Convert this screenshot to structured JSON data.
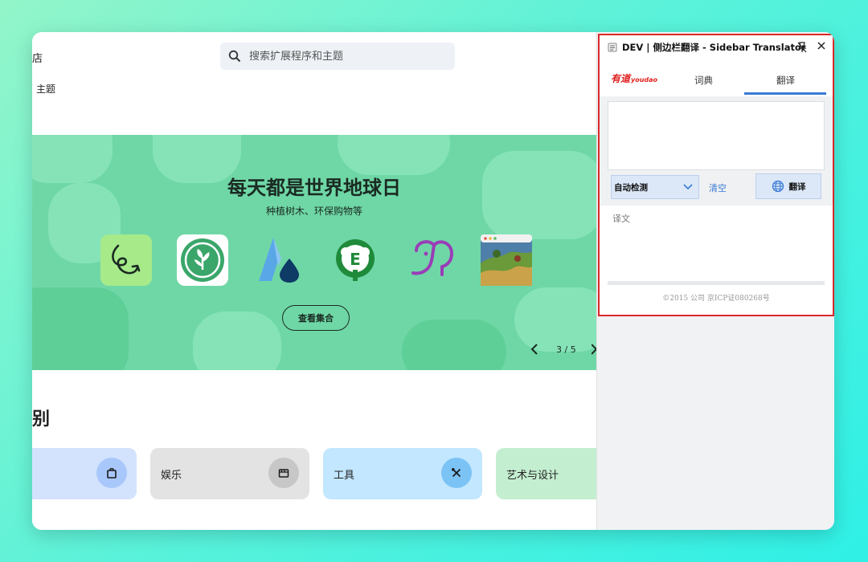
{
  "store": {
    "nav_store": "商店",
    "nav_themes": "主题",
    "search": {
      "placeholder": "搜索扩展程序和主题"
    },
    "hero": {
      "title": "每天都是世界地球日",
      "subtitle": "种植树木、环保购物等",
      "button": "查看集合",
      "pager": "3 / 5",
      "app_icons": [
        "loop-arrow-app-icon",
        "leaf-app-icon",
        "water-drop-app-icon",
        "tree-e-app-icon",
        "elephant-app-icon",
        "landscape-app-icon"
      ]
    },
    "categories_heading": "类别",
    "categories": [
      {
        "label": "",
        "icon": "shopping-bag-icon",
        "bg": "#d3e3fd"
      },
      {
        "label": "娱乐",
        "icon": "clapperboard-icon",
        "bg": "#e3e3e3"
      },
      {
        "label": "工具",
        "icon": "tools-icon",
        "bg": "#c2e7ff"
      },
      {
        "label": "艺术与设计",
        "icon": "",
        "bg": "#c4eed0"
      }
    ]
  },
  "translator": {
    "title": "DEV | 侧边栏翻译 - Sidebar Translator",
    "logo_cn": "有道",
    "logo_en": "youdao",
    "tabs": {
      "dictionary": "词典",
      "translate": "翻译"
    },
    "input_value": "",
    "source_lang": "自动检测",
    "clear": "清空",
    "translate_button": "翻译",
    "output_label": "译文",
    "footer": "©2015 公司 京ICP证080268号",
    "colors": {
      "highlight_border": "#d9292b",
      "accent": "#3a7bd5",
      "brand": "#e0201f"
    }
  }
}
